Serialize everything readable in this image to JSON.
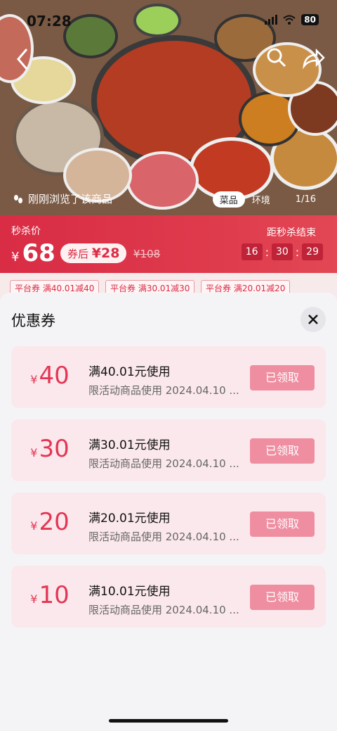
{
  "status_bar": {
    "time": "07:28",
    "battery": "80"
  },
  "gallery": {
    "viewed_text": "刚刚浏览了该商品",
    "tags": [
      "菜品",
      "环境"
    ],
    "page_indicator": "1/16"
  },
  "flash_sale": {
    "label": "秒杀价",
    "yen": "¥",
    "price": "68",
    "after_coupon_label": "券后",
    "after_coupon_price": "¥28",
    "original_price": "¥108",
    "countdown_label": "距秒杀结束",
    "countdown": {
      "h": "16",
      "m": "30",
      "s": "29"
    },
    "countdown_sep": ":"
  },
  "coupon_strip": [
    "平台券  满40.01减40",
    "平台券  满30.01减30",
    "平台券  满20.01减20"
  ],
  "sheet": {
    "title": "优惠券",
    "coupons": [
      {
        "yen": "¥",
        "amount": "40",
        "condition": "满40.01元使用",
        "desc": "限活动商品使用 2024.04.10 ...",
        "button": "已领取"
      },
      {
        "yen": "¥",
        "amount": "30",
        "condition": "满30.01元使用",
        "desc": "限活动商品使用 2024.04.10 ...",
        "button": "已领取"
      },
      {
        "yen": "¥",
        "amount": "20",
        "condition": "满20.01元使用",
        "desc": "限活动商品使用 2024.04.10 ...",
        "button": "已领取"
      },
      {
        "yen": "¥",
        "amount": "10",
        "condition": "满10.01元使用",
        "desc": "限活动商品使用 2024.04.10 ...",
        "button": "已领取"
      }
    ]
  },
  "colors": {
    "accent": "#d92c45",
    "coupon_bg": "#fbe8ec",
    "button": "#ef8ea1"
  }
}
